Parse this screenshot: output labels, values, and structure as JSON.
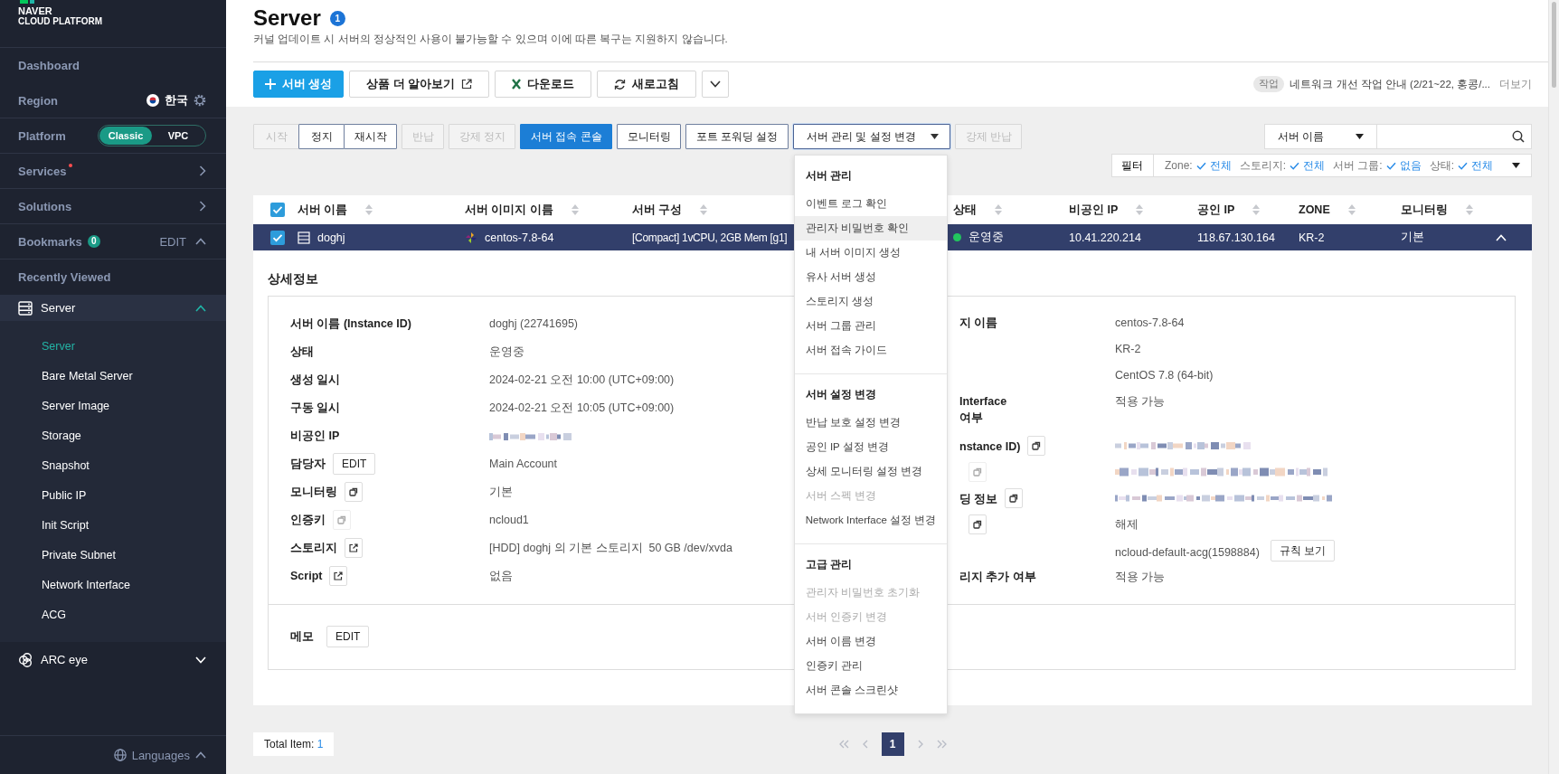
{
  "sidebar": {
    "logo": [
      "NAVER",
      "CLOUD PLATFORM"
    ],
    "items": [
      {
        "kind": "link",
        "label": "Dashboard"
      },
      {
        "kind": "region",
        "label": "Region",
        "value": "한국"
      },
      {
        "kind": "platform",
        "label": "Platform",
        "options": [
          {
            "label": "Classic",
            "selected": true
          },
          {
            "label": "VPC",
            "selected": false
          }
        ]
      },
      {
        "kind": "nav",
        "label": "Services",
        "alert": true
      },
      {
        "kind": "nav",
        "label": "Solutions",
        "alert": false
      },
      {
        "kind": "bookmarks",
        "label": "Bookmarks",
        "count": "0",
        "action": "EDIT",
        "expanded": true
      },
      {
        "kind": "link",
        "label": "Recently Viewed"
      },
      {
        "kind": "group",
        "label": "Server",
        "expanded": true,
        "children": [
          {
            "label": "Server",
            "selected": true
          },
          {
            "label": "Bare Metal Server",
            "selected": false
          },
          {
            "label": "Server Image",
            "selected": false
          },
          {
            "label": "Storage",
            "selected": false
          },
          {
            "label": "Snapshot",
            "selected": false
          },
          {
            "label": "Public IP",
            "selected": false
          },
          {
            "label": "Init Script",
            "selected": false
          },
          {
            "label": "Private Subnet",
            "selected": false
          },
          {
            "label": "Network Interface",
            "selected": false
          },
          {
            "label": "ACG",
            "selected": false
          }
        ]
      },
      {
        "kind": "group",
        "label": "ARC eye",
        "expanded": false
      }
    ],
    "footer": "Languages"
  },
  "header": {
    "title": "Server",
    "badge": "1",
    "subtitle": "커널 업데이트 시 서버의 정상적인 사용이 불가능할 수 있으며 이에 따른 복구는 지원하지 않습니다."
  },
  "toolbar": [
    {
      "kind": "primary",
      "label": "서버 생성"
    },
    {
      "kind": "external",
      "label": "상품 더 알아보기"
    },
    {
      "kind": "download",
      "label": "다운로드"
    },
    {
      "kind": "refresh",
      "label": "새로고침"
    },
    {
      "kind": "more"
    }
  ],
  "notice": {
    "tag": "작업",
    "text": "네트워크 개선 작업 안내 (2/21~22, 홍콩/...",
    "more": "더보기"
  },
  "actions": [
    {
      "kind": "group",
      "buttons": [
        {
          "label": "시작",
          "disabled": true
        },
        {
          "label": "정지",
          "disabled": false
        },
        {
          "label": "재시작",
          "disabled": false
        }
      ]
    },
    {
      "kind": "button",
      "label": "반납",
      "disabled": true
    },
    {
      "kind": "button",
      "label": "강제 정지",
      "disabled": true
    },
    {
      "kind": "primary",
      "label": "서버 접속 콘솔",
      "disabled": false
    },
    {
      "kind": "button",
      "label": "모니터링",
      "disabled": false
    },
    {
      "kind": "button",
      "label": "포트 포워딩 설정",
      "disabled": false
    },
    {
      "kind": "dropdown",
      "label": "서버 관리 및 설정 변경",
      "expanded": true,
      "menu": {
        "sections": [
          {
            "title": "서버 관리",
            "items": [
              {
                "label": "이벤트 로그 확인",
                "disabled": false,
                "highlighted": false
              },
              {
                "label": "관리자 비밀번호 확인",
                "disabled": false,
                "highlighted": true
              },
              {
                "label": "내 서버 이미지 생성",
                "disabled": false,
                "highlighted": false
              },
              {
                "label": "유사 서버 생성",
                "disabled": false,
                "highlighted": false
              },
              {
                "label": "스토리지 생성",
                "disabled": false,
                "highlighted": false
              },
              {
                "label": "서버 그룹 관리",
                "disabled": false,
                "highlighted": false
              },
              {
                "label": "서버 접속 가이드",
                "disabled": false,
                "highlighted": false
              }
            ]
          },
          {
            "title": "서버 설정 변경",
            "items": [
              {
                "label": "반납 보호 설정 변경",
                "disabled": false,
                "highlighted": false
              },
              {
                "label": "공인 IP 설정 변경",
                "disabled": false,
                "highlighted": false
              },
              {
                "label": "상세 모니터링 설정 변경",
                "disabled": false,
                "highlighted": false
              },
              {
                "label": "서버 스펙 변경",
                "disabled": true,
                "highlighted": false
              },
              {
                "label": "Network Interface 설정 변경",
                "disabled": false,
                "highlighted": false
              }
            ]
          },
          {
            "title": "고급 관리",
            "items": [
              {
                "label": "관리자 비밀번호 초기화",
                "disabled": true,
                "highlighted": false
              },
              {
                "label": "서버 인증키 변경",
                "disabled": true,
                "highlighted": false
              },
              {
                "label": "서버 이름 변경",
                "disabled": false,
                "highlighted": false
              },
              {
                "label": "인증키 관리",
                "disabled": false,
                "highlighted": false
              },
              {
                "label": "서버 콘솔 스크린샷",
                "disabled": false,
                "highlighted": false
              }
            ]
          }
        ]
      }
    },
    {
      "kind": "button",
      "label": "강제 반납",
      "disabled": true
    }
  ],
  "search": {
    "field": "서버 이름"
  },
  "filter": {
    "label": "필터",
    "items": [
      {
        "name": "Zone:",
        "value": "전체"
      },
      {
        "name": "스토리지:",
        "value": "전체"
      },
      {
        "name": "서버 그룹:",
        "value": "없음"
      },
      {
        "name": "상태:",
        "value": "전체"
      }
    ]
  },
  "table": {
    "select_all": true,
    "columns": [
      "서버 이름",
      "서버 이미지 이름",
      "서버 구성",
      "상태",
      "비공인 IP",
      "공인 IP",
      "ZONE",
      "모니터링"
    ],
    "rows": [
      {
        "checked": true,
        "expanded": true,
        "name": "doghj",
        "image": "centos-7.8-64",
        "spec": "[Compact] 1vCPU, 2GB Mem [g1]",
        "status": "운영중",
        "color": "#22c55e",
        "private_ip": "10.41.220.214",
        "public_ip": "118.67.130.164",
        "zone": "KR-2",
        "monitoring": "기본"
      }
    ]
  },
  "detail": {
    "title": "상세정보",
    "left": [
      {
        "kind": "text",
        "label": "서버 이름 (Instance ID)",
        "value": "doghj (22741695)"
      },
      {
        "kind": "text",
        "label": "상태",
        "value": "운영중"
      },
      {
        "kind": "text",
        "label": "생성 일시",
        "value": "2024-02-21 오전 10:00 (UTC+09:00)"
      },
      {
        "kind": "text",
        "label": "구동 일시",
        "value": "2024-02-21 오전 10:05 (UTC+09:00)"
      },
      {
        "kind": "text",
        "label": "비공인 IP",
        "redacted": true
      },
      {
        "kind": "edit",
        "label": "담당자",
        "button": "EDIT",
        "value": "Main Account"
      },
      {
        "kind": "copy",
        "label": "모니터링",
        "icon_disabled": false,
        "value": "기본"
      },
      {
        "kind": "copy",
        "label": "인증키",
        "icon_disabled": true,
        "value": "ncloud1"
      },
      {
        "kind": "link",
        "label": "스토리지",
        "icon_disabled": false,
        "value": "[HDD] doghj 의 기본 스토리지  50 GB /dev/xvda"
      },
      {
        "kind": "link",
        "label": "Script",
        "icon_disabled": false,
        "value": "없음"
      }
    ],
    "right": [
      {
        "kind": "text",
        "label": "지 이름",
        "value": "centos-7.8-64"
      },
      {
        "kind": "text",
        "value": "KR-2"
      },
      {
        "kind": "text",
        "value": "CentOS 7.8 (64-bit)"
      },
      {
        "kind": "text",
        "label": "Interface\n여부",
        "value": "적용 가능"
      },
      {
        "kind": "copy",
        "label": "nstance ID)",
        "icon_disabled": false,
        "redacted": true
      },
      {
        "kind": "copy",
        "icon_disabled": true,
        "redacted": true
      },
      {
        "kind": "copy",
        "label": "딩 정보",
        "icon_disabled": false,
        "redacted": true
      },
      {
        "kind": "copy",
        "icon_disabled": false,
        "value": "해제"
      },
      {
        "kind": "rules",
        "value": "ncloud-default-acg(1598884)",
        "button": "규칙 보기"
      },
      {
        "kind": "text",
        "label": "리지 추가 여부",
        "value": "적용 가능"
      }
    ],
    "memo": {
      "label": "메모",
      "button": "EDIT"
    }
  },
  "footer": {
    "total_label": "Total Item:",
    "total": "1",
    "pages": [
      {
        "label": "1",
        "selected": true
      }
    ]
  }
}
